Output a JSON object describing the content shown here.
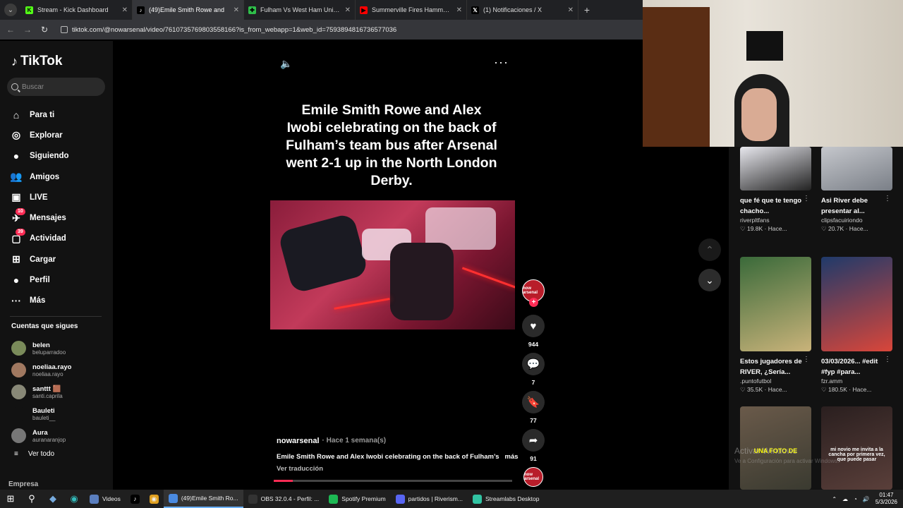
{
  "browser": {
    "tabs": [
      {
        "title": "Stream - Kick Dashboard",
        "favicon_color": "#53fc18",
        "favicon": "K",
        "active": false
      },
      {
        "title": "(49)Emile Smith Rowe and",
        "favicon_color": "#000000",
        "favicon": "♪",
        "active": true
      },
      {
        "title": "Fulham Vs West Ham United -",
        "favicon_color": "#2fbf4a",
        "favicon": "✚",
        "active": false
      },
      {
        "title": "Summerville Fires Hammers To",
        "favicon_color": "#ff0000",
        "favicon": "▶",
        "active": false
      },
      {
        "title": "(1) Notificaciones / X",
        "favicon_color": "#000000",
        "favicon": "𝕏",
        "active": false
      }
    ],
    "url": "tiktok.com/@nowarsenal/video/7610735769803558166?is_from_webapp=1&web_id=7593894816736577036"
  },
  "sidebar": {
    "logo": "TikTok",
    "search_placeholder": "Buscar",
    "nav": [
      {
        "label": "Para ti",
        "icon": "⌂",
        "badge": ""
      },
      {
        "label": "Explorar",
        "icon": "◎",
        "badge": ""
      },
      {
        "label": "Siguiendo",
        "icon": "●",
        "badge": ""
      },
      {
        "label": "Amigos",
        "icon": "👥",
        "badge": ""
      },
      {
        "label": "LIVE",
        "icon": "▣",
        "badge": ""
      },
      {
        "label": "Mensajes",
        "icon": "✈",
        "badge": "10"
      },
      {
        "label": "Actividad",
        "icon": "▢",
        "badge": "39"
      },
      {
        "label": "Cargar",
        "icon": "⊞",
        "badge": ""
      },
      {
        "label": "Perfil",
        "icon": "●",
        "badge": ""
      },
      {
        "label": "Más",
        "icon": "···",
        "badge": ""
      }
    ],
    "following_title": "Cuentas que sigues",
    "following": [
      {
        "name": "belen",
        "handle": "beluparradoo",
        "color": "#7a8b5a"
      },
      {
        "name": "noeliaa.rayo",
        "handle": "noeliaa.rayo",
        "color": "#a07860"
      },
      {
        "name": "santtt 🟫",
        "handle": "santi.caprila",
        "color": "#888877"
      },
      {
        "name": "Bauleti",
        "handle": "bauleti__",
        "color": "#121212"
      },
      {
        "name": "Aura",
        "handle": "auranaranjop",
        "color": "#777777"
      }
    ],
    "see_all": "Ver todo",
    "footer": "Empresa"
  },
  "video": {
    "caption": "Emile Smith Rowe and Alex Iwobi celebrating on the back of Fulham’s team bus after Arsenal went 2-1 up in the North London Derby.",
    "author": "nowarsenal",
    "ago": "· Hace 1 semana(s)",
    "description": "Emile Smith Rowe and Alex Iwobi celebrating on the back of Fulham’s",
    "more": "más",
    "translate": "Ver traducción",
    "progress": 0.08,
    "likes": "944",
    "comments": "7",
    "saves": "77",
    "shares": "91",
    "channel_badge": "now arsenal"
  },
  "recommended": [
    {
      "title": "que fé que te tengo chacho...",
      "user": "riverpltfans",
      "stat": "♡ 19.8K · Hace...",
      "c1": "#e8e8ee",
      "c2": "#222"
    },
    {
      "title": "Asi River debe presentar al...",
      "user": "clipsfacuiriondo",
      "stat": "♡ 20.7K · Hace...",
      "c1": "#c5c7cc",
      "c2": "#7a7f87"
    },
    {
      "title": "Estos jugadores de RIVER, ¿Sería...",
      "user": ".puntofutbol",
      "stat": "♡ 35.5K · Hace...",
      "c1": "#3a6a3a",
      "c2": "#c9b37a"
    },
    {
      "title": "03/03/2026... #edit #fyp #para...",
      "user": "fzr.amm",
      "stat": "♡ 180.5K · Hace...",
      "c1": "#1f3a6a",
      "c2": "#d9463a"
    },
    {
      "title": "",
      "user": "",
      "stat": "",
      "c1": "#6a5a4a",
      "c2": "#3a3a30",
      "overlay": "UNA FOTO DE"
    },
    {
      "title": "",
      "user": "",
      "stat": "",
      "c1": "#2a1f1f",
      "c2": "#5a3f3a",
      "overlay": "mi novio me invita a la cancha por primera vez, que puede pasar"
    }
  ],
  "watermark": {
    "line1": "Activar Windows",
    "line2": "Ve a Configuración para activar Windows."
  },
  "taskbar": {
    "apps": [
      {
        "label": "Videos",
        "color": "#5b7fbf",
        "active": false
      },
      {
        "label": "",
        "color": "#000000",
        "active": false,
        "icon": "♪"
      },
      {
        "label": "",
        "color": "#e0a020",
        "active": false,
        "icon": "◉"
      },
      {
        "label": "(49)Emile Smith Ro...",
        "color": "#4a8ae0",
        "active": true
      },
      {
        "label": "OBS 32.0.4 - Perfil: ...",
        "color": "#333333",
        "active": false
      },
      {
        "label": "Spotify Premium",
        "color": "#1db954",
        "active": false
      },
      {
        "label": "partidos | Riverism...",
        "color": "#5865f2",
        "active": false
      },
      {
        "label": "Streamlabs Desktop",
        "color": "#31c3a2",
        "active": false
      }
    ],
    "time": "01:47",
    "date": "5/3/2026"
  }
}
